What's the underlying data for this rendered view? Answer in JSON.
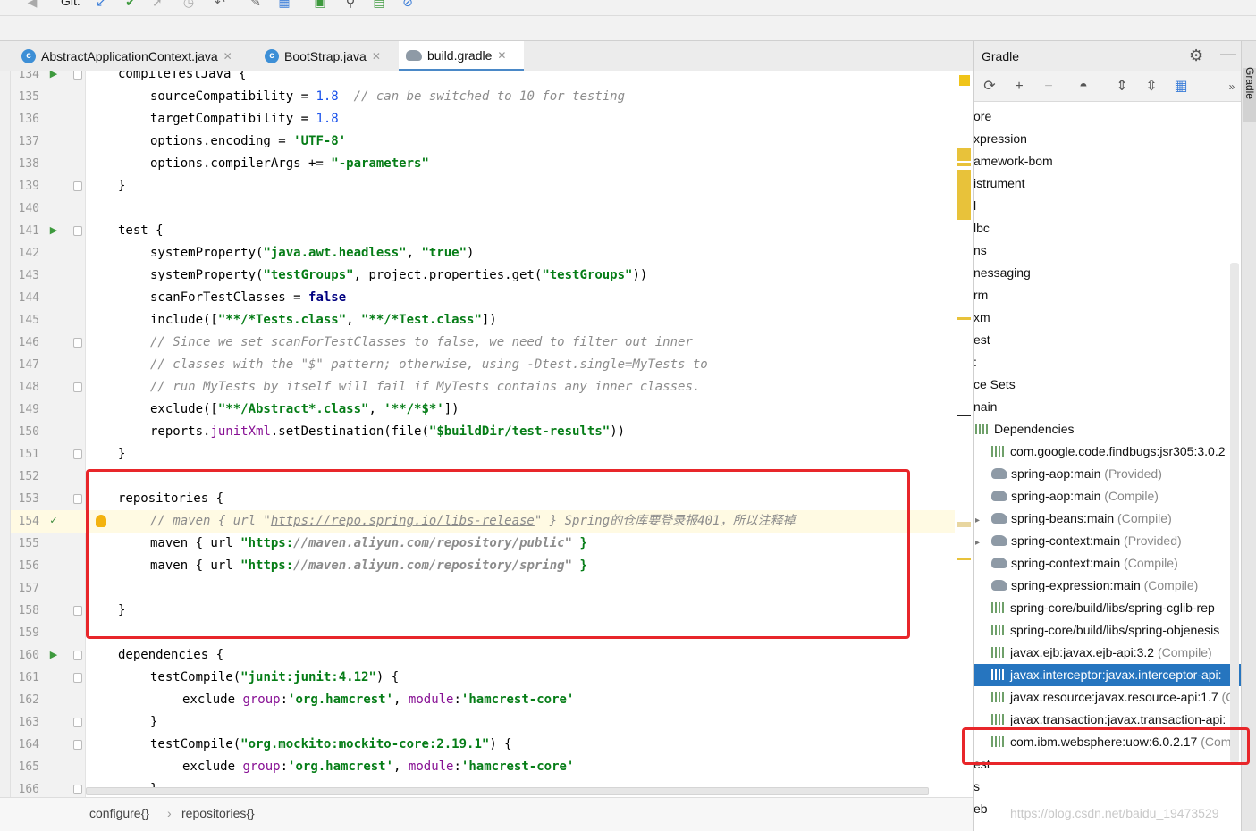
{
  "toolbar": {
    "vcs_label": "Git:"
  },
  "tabs": [
    {
      "label": "AbstractApplicationContext.java",
      "icon": "java-class-icon"
    },
    {
      "label": "BootStrap.java",
      "icon": "java-class-icon"
    },
    {
      "label": "build.gradle",
      "icon": "gradle-elephant-icon",
      "active": true
    }
  ],
  "editor": {
    "lines": [
      {
        "num": "134",
        "text": "compileTestJava {"
      },
      {
        "num": "135",
        "text": "sourceCompatibility = 1.8  // can be switched to 10 for testing"
      },
      {
        "num": "136",
        "text": "targetCompatibility = 1.8"
      },
      {
        "num": "137",
        "text": "options.encoding = 'UTF-8'"
      },
      {
        "num": "138",
        "text": "options.compilerArgs += \"-parameters\""
      },
      {
        "num": "139",
        "text": "}"
      },
      {
        "num": "140",
        "text": ""
      },
      {
        "num": "141",
        "text": "test {"
      },
      {
        "num": "142",
        "text": "systemProperty(\"java.awt.headless\", \"true\")"
      },
      {
        "num": "143",
        "text": "systemProperty(\"testGroups\", project.properties.get(\"testGroups\"))"
      },
      {
        "num": "144",
        "text": "scanForTestClasses = false"
      },
      {
        "num": "145",
        "text": "include([\"**/*Tests.class\", \"**/*Test.class\"])"
      },
      {
        "num": "146",
        "text": "// Since we set scanForTestClasses to false, we need to filter out inner"
      },
      {
        "num": "147",
        "text": "// classes with the \"$\" pattern; otherwise, using -Dtest.single=MyTests to"
      },
      {
        "num": "148",
        "text": "// run MyTests by itself will fail if MyTests contains any inner classes."
      },
      {
        "num": "149",
        "text": "exclude([\"**/Abstract*.class\", '**/*$*'])"
      },
      {
        "num": "150",
        "text": "reports.junitXml.setDestination(file(\"$buildDir/test-results\"))"
      },
      {
        "num": "151",
        "text": "}"
      },
      {
        "num": "152",
        "text": ""
      },
      {
        "num": "153",
        "text": "repositories {"
      },
      {
        "num": "154",
        "text": "// maven { url \"https://repo.spring.io/libs-release\" } Spring的仓库要登录报401，所以注释掉"
      },
      {
        "num": "155",
        "text": "maven { url \"https://maven.aliyun.com/repository/public\" }"
      },
      {
        "num": "156",
        "text": "maven { url \"https://maven.aliyun.com/repository/spring\" }"
      },
      {
        "num": "157",
        "text": ""
      },
      {
        "num": "158",
        "text": "}"
      },
      {
        "num": "159",
        "text": ""
      },
      {
        "num": "160",
        "text": "dependencies {"
      },
      {
        "num": "161",
        "text": "testCompile(\"junit:junit:4.12\") {"
      },
      {
        "num": "162",
        "text": "exclude group:'org.hamcrest', module:'hamcrest-core'"
      },
      {
        "num": "163",
        "text": "}"
      },
      {
        "num": "164",
        "text": "testCompile(\"org.mockito:mockito-core:2.19.1\") {"
      },
      {
        "num": "165",
        "text": "exclude group:'org.hamcrest', module:'hamcrest-core'"
      },
      {
        "num": "166",
        "text": "}"
      }
    ]
  },
  "breadcrumb": {
    "first": "configure{}",
    "separator": "›",
    "second": "repositories{}"
  },
  "gradle": {
    "title": "Gradle",
    "tree": [
      {
        "label": "ore"
      },
      {
        "label": "xpression"
      },
      {
        "label": "amework-bom"
      },
      {
        "label": "istrument"
      },
      {
        "label": "l"
      },
      {
        "label": "lbc"
      },
      {
        "label": "ns"
      },
      {
        "label": "nessaging"
      },
      {
        "label": "rm"
      },
      {
        "label": "xm"
      },
      {
        "label": "est"
      },
      {
        "label": ":"
      },
      {
        "label": "ce Sets"
      },
      {
        "label": "nain"
      },
      {
        "label": "Dependencies"
      },
      {
        "label": "com.google.code.findbugs:jsr305:3.0.2",
        "suffix": ""
      },
      {
        "label": "spring-aop:main",
        "suffix": "(Provided)"
      },
      {
        "label": "spring-aop:main",
        "suffix": "(Compile)"
      },
      {
        "label": "spring-beans:main",
        "suffix": "(Compile)"
      },
      {
        "label": "spring-context:main",
        "suffix": "(Provided)"
      },
      {
        "label": "spring-context:main",
        "suffix": "(Compile)"
      },
      {
        "label": "spring-expression:main",
        "suffix": "(Compile)"
      },
      {
        "label": "spring-core/build/libs/spring-cglib-rep",
        "suffix": ""
      },
      {
        "label": "spring-core/build/libs/spring-objenesis",
        "suffix": ""
      },
      {
        "label": "javax.ejb:javax.ejb-api:3.2",
        "suffix": "(Compile)"
      },
      {
        "label": "javax.interceptor:javax.interceptor-api:",
        "suffix": ""
      },
      {
        "label": "javax.resource:javax.resource-api:1.7",
        "suffix": "(C"
      },
      {
        "label": "javax.transaction:javax.transaction-api:",
        "suffix": ""
      },
      {
        "label": "com.ibm.websphere:uow:6.0.2.17",
        "suffix": "(Com"
      },
      {
        "label": "est"
      },
      {
        "label": "s"
      },
      {
        "label": "eb"
      }
    ]
  },
  "side_tab": {
    "label": "Gradle"
  },
  "watermark": "https://blog.csdn.net/baidu_19473529"
}
